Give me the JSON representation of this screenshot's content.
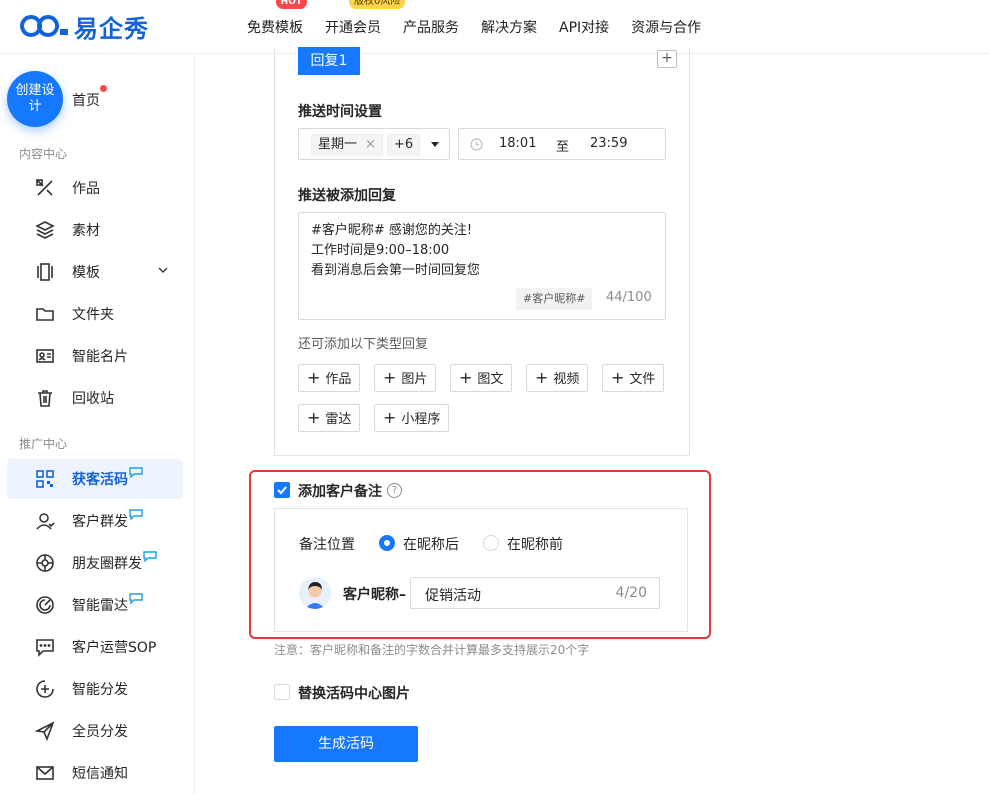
{
  "header": {
    "logo_text": "易企秀",
    "nav": [
      {
        "label": "免费模板",
        "badge": "HOT"
      },
      {
        "label": "开通会员",
        "badge": "版权0风险"
      },
      {
        "label": "产品服务"
      },
      {
        "label": "解决方案"
      },
      {
        "label": "API对接"
      },
      {
        "label": "资源与合作"
      }
    ]
  },
  "sidebar": {
    "create_button": "创建设计",
    "home": "首页",
    "section_content": "内容中心",
    "content_items": [
      "作品",
      "素材",
      "模板",
      "文件夹",
      "智能名片",
      "回收站"
    ],
    "section_promo": "推广中心",
    "promo_items": [
      "获客活码",
      "客户群发",
      "朋友圈群发",
      "智能雷达",
      "客户运营SOP",
      "智能分发",
      "全员分发",
      "短信通知"
    ],
    "active_item": "获客活码"
  },
  "form": {
    "reply_tab": "回复1",
    "add_tab_symbol": "+",
    "push_time_label": "推送时间设置",
    "weekday_tag": "星期一",
    "weekday_close": "×",
    "weekday_more": "+6",
    "time_start": "18:01",
    "time_separator": "至",
    "time_end": "23:59",
    "reply_label": "推送被添加回复",
    "reply_line1": "#客户昵称# 感谢您的关注!",
    "reply_line2": "工作时间是9:00–18:00",
    "reply_line3": "看到消息后会第一时间回复您",
    "nickname_var": "#客户昵称#",
    "reply_counter": "44/100",
    "add_hint": "还可添加以下类型回复",
    "add_types": [
      "作品",
      "图片",
      "图文",
      "视频",
      "文件",
      "雷达",
      "小程序"
    ],
    "add_remark_label": "添加客户备注",
    "add_remark_checked": true,
    "help_symbol": "?",
    "remark_position_label": "备注位置",
    "option_after": "在昵称后",
    "option_before": "在昵称前",
    "selected_option": "在昵称后",
    "nickname_prefix": "客户昵称–",
    "remark_value": "促销活动",
    "remark_counter": "4/20",
    "note": "注意：客户昵称和备注的字数合并计算最多支持展示20个字",
    "replace_image_label": "替换活码中心图片",
    "replace_image_checked": false,
    "generate_button": "生成活码"
  },
  "colors": {
    "primary": "#1677ff",
    "highlight_frame": "#e8363a"
  }
}
